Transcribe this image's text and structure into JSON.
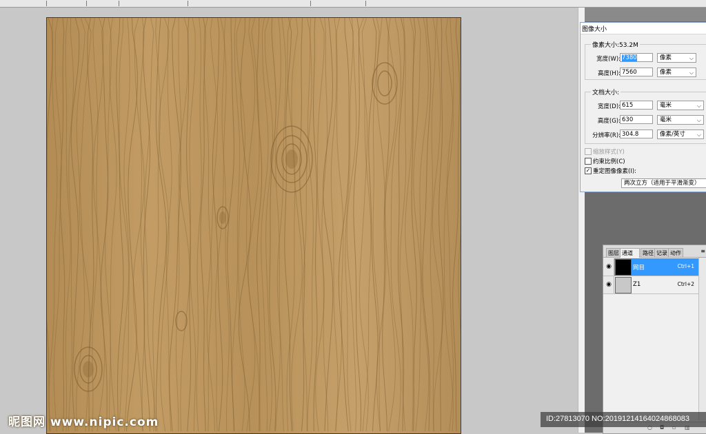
{
  "dialog": {
    "title": "图像大小",
    "pixel_dimensions": {
      "label": "像素大小:53.2M",
      "width_label": "宽度(W):",
      "width_value": "7380",
      "width_unit": "像素",
      "height_label": "高度(H):",
      "height_value": "7560",
      "height_unit": "像素"
    },
    "document_size": {
      "label": "文档大小:",
      "width_label": "宽度(D):",
      "width_value": "615",
      "width_unit": "毫米",
      "height_label": "高度(G):",
      "height_value": "630",
      "height_unit": "毫米",
      "resolution_label": "分辨率(R):",
      "resolution_value": "304.8",
      "resolution_unit": "像素/英寸"
    },
    "options": {
      "scale_styles": "缩放样式(Y)",
      "scale_styles_checked": false,
      "scale_styles_disabled": true,
      "constrain": "约束比例(C)",
      "constrain_checked": false,
      "resample": "重定图像像素(I):",
      "resample_checked": true,
      "resample_method": "两次立方（适用于平滑渐变）"
    }
  },
  "channels_panel": {
    "tabs": [
      "图层",
      "通道",
      "路径",
      "记录",
      "动作"
    ],
    "active_tab": "通道",
    "close_glyph": "×",
    "rows": [
      {
        "name": "网目",
        "shortcut": "Ctrl+1",
        "active": true
      },
      {
        "name": "Z1",
        "shortcut": "Ctrl+2",
        "active": false
      }
    ]
  },
  "overlay": {
    "watermark": "昵图网 www.nipic.com",
    "id_text": "ID:27813070 NO:20191214164024868083"
  },
  "colors": {
    "selection_blue": "#3399ff",
    "wood_base": "#b8925a",
    "wood_grain": "#8a6a3c"
  },
  "icons": [
    "eye-icon",
    "chevron-down-icon",
    "panel-menu-icon",
    "close-icon"
  ]
}
